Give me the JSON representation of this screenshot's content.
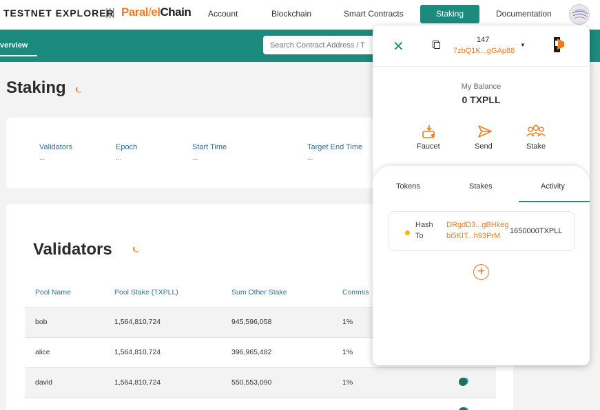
{
  "header": {
    "brand": "TESTNET EXPLORER",
    "separator": "|||",
    "logo": {
      "part1": "Paral",
      "slash": "/",
      "part2": "el",
      "part3": "Chain"
    },
    "nav": [
      "Account",
      "Blockchain",
      "Smart Contracts",
      "Staking",
      "Documentation"
    ],
    "active_nav": "Staking"
  },
  "subnav": {
    "tab": "verview",
    "search_placeholder": "Search Contract Address / T"
  },
  "page": {
    "title": "Staking",
    "stats": [
      {
        "label": "Validators",
        "value": "..."
      },
      {
        "label": "Epoch",
        "value": "..."
      },
      {
        "label": "Start Time",
        "value": "..."
      },
      {
        "label": "Target End Time",
        "value": "..."
      }
    ]
  },
  "validators": {
    "title": "Validators",
    "columns": [
      "Pool Name",
      "Pool Stake (TXPLL)",
      "Sum Other Stake",
      "Commis"
    ],
    "rows": [
      {
        "name": "bob",
        "pool_stake": "1,564,810,724",
        "other_stake": "945,596,058",
        "commission": "1%"
      },
      {
        "name": "alice",
        "pool_stake": "1,564,810,724",
        "other_stake": "396,965,482",
        "commission": "1%"
      },
      {
        "name": "david",
        "pool_stake": "1,564,810,724",
        "other_stake": "550,553,090",
        "commission": "1%"
      }
    ]
  },
  "wallet": {
    "close_icon": "✕",
    "account_number": "147",
    "address": "7zbQ1K...gGAp88",
    "dropdown_icon": "▼",
    "balance_label": "My Balance",
    "balance": "0 TXPLL",
    "actions": [
      {
        "label": "Faucet",
        "icon": "faucet-icon"
      },
      {
        "label": "Send",
        "icon": "send-icon"
      },
      {
        "label": "Stake",
        "icon": "stake-icon"
      }
    ],
    "tabs": [
      "Tokens",
      "Stakes",
      "Activity"
    ],
    "active_tab": "Activity",
    "activity": [
      {
        "hash_label": "Hash",
        "to_label": "To",
        "hash": "DRgdD3...gBHkeg",
        "to": "bi5KIT...h93PrM",
        "amount": "1650000TXPLL"
      }
    ],
    "add_icon": "+"
  },
  "colors": {
    "accent": "#1c8a7c",
    "brand_orange": "#f07b1f"
  }
}
